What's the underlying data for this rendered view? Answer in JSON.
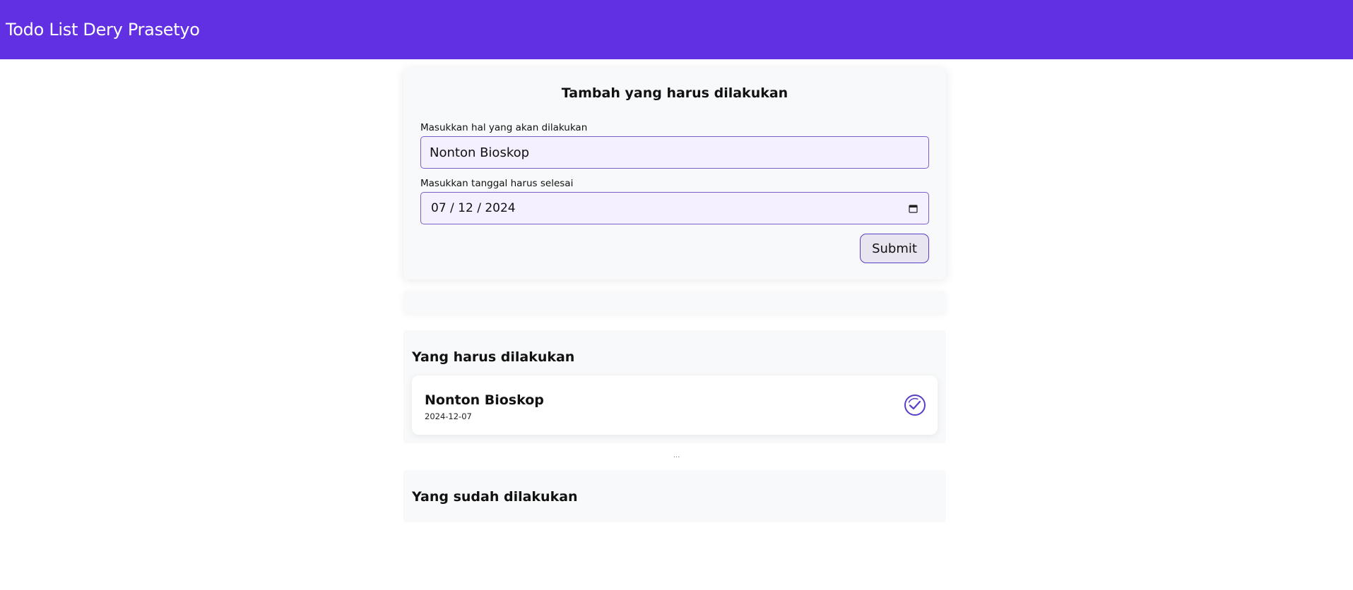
{
  "app": {
    "title": "Todo List Dery Prasetyo",
    "accent_color": "#6230e3"
  },
  "form": {
    "title": "Tambah yang harus dilakukan",
    "title_label": "Masukkan hal yang akan dilakukan",
    "title_value": "Nonton Bioskop",
    "date_label": "Masukkan tanggal harus selesai",
    "date_value": "07 / 12 / 2024",
    "date_icon": "calendar-icon",
    "submit_label": "Submit"
  },
  "todo": {
    "title": "Yang harus dilakukan",
    "items": [
      {
        "title": "Nonton Bioskop",
        "date": "2024-12-07",
        "action_icon": "check-circle-icon"
      }
    ]
  },
  "divider": "...",
  "done": {
    "title": "Yang sudah dilakukan",
    "items": []
  }
}
